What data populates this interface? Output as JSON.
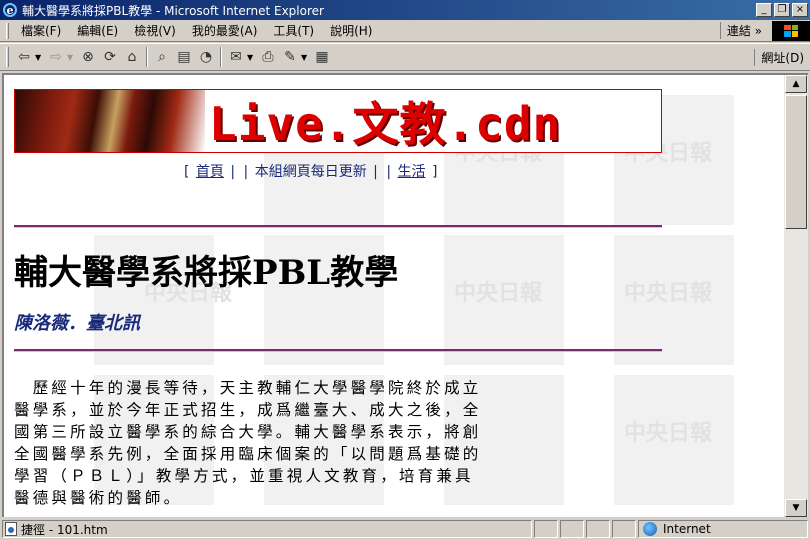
{
  "window": {
    "title": "輔大醫學系將採PBL教學 - Microsoft Internet Explorer",
    "minimize": "_",
    "restore": "❐",
    "close": "×"
  },
  "menubar": {
    "items": [
      "檔案(F)",
      "編輯(E)",
      "檢視(V)",
      "我的最愛(A)",
      "工具(T)",
      "說明(H)"
    ],
    "links_label": "連結",
    "links_chevron": "»"
  },
  "toolbar": {
    "address_label": "網址(D)",
    "icons": [
      "back-icon",
      "forward-icon",
      "stop-icon",
      "refresh-icon",
      "home-icon",
      "search-icon",
      "favorites-icon",
      "history-icon",
      "mail-icon",
      "print-icon",
      "edit-icon",
      "discuss-icon"
    ]
  },
  "page": {
    "banner_text": "Live.文教.cdn",
    "nav": {
      "open_bracket": "[",
      "links": [
        "首頁",
        "本組網頁每日更新",
        "生活"
      ],
      "separator": "|",
      "close_bracket": "]"
    },
    "headline": "輔大醫學系將採PBL教學",
    "byline": "陳洛薇．臺北訊",
    "article_lines": [
      "　歷經十年的漫長等待，天主教輔仁大學醫學院終於成立",
      "醫學系，並於今年正式招生，成爲繼臺大、成大之後，全",
      "國第三所設立醫學系的綜合大學。輔大醫學系表示，將創",
      "全國醫學系先例，全面採用臨床個案的「以問題爲基礎的",
      "學習（ＰＢＬ）」教學方式，並重視人文教育，培育兼具",
      "醫德與醫術的醫師。"
    ],
    "watermark_text": "中央日報"
  },
  "statusbar": {
    "text": "捷徑 - 101.htm",
    "zone": "Internet"
  },
  "colors": {
    "titlebar_start": "#0a246a",
    "titlebar_end": "#3a6ea5",
    "link": "#1a2a7a",
    "rule": "#7a2a6a",
    "banner_red": "#d00000"
  }
}
